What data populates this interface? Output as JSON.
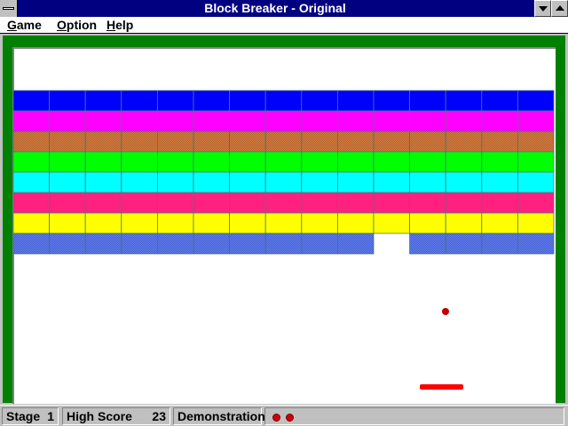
{
  "window": {
    "title": "Block Breaker - Original"
  },
  "menu": {
    "items": [
      "Game",
      "Option",
      "Help"
    ]
  },
  "game": {
    "brick_columns": 15,
    "rows": [
      {
        "color": "#0000ff",
        "pattern": "solid"
      },
      {
        "color": "#ff00ff",
        "pattern": "solid"
      },
      {
        "color": "#e08040",
        "pattern": "dithered"
      },
      {
        "color": "#00ff00",
        "pattern": "solid"
      },
      {
        "color": "#00ffff",
        "pattern": "solid"
      },
      {
        "color": "#ff2080",
        "pattern": "solid"
      },
      {
        "color": "#ffff00",
        "pattern": "solid"
      },
      {
        "color": "#6080ff",
        "pattern": "dithered"
      }
    ],
    "missing_bricks": [
      {
        "row": 7,
        "col": 10
      }
    ],
    "ball_color": "#c00000",
    "paddle_color": "#ff0000",
    "frame_color": "#008000"
  },
  "status": {
    "stage_label": "Stage",
    "stage_value": "1",
    "high_score_label": "High Score",
    "high_score_value": "23",
    "mode": "Demonstration",
    "lives": 2,
    "life_color": "#d00000"
  }
}
